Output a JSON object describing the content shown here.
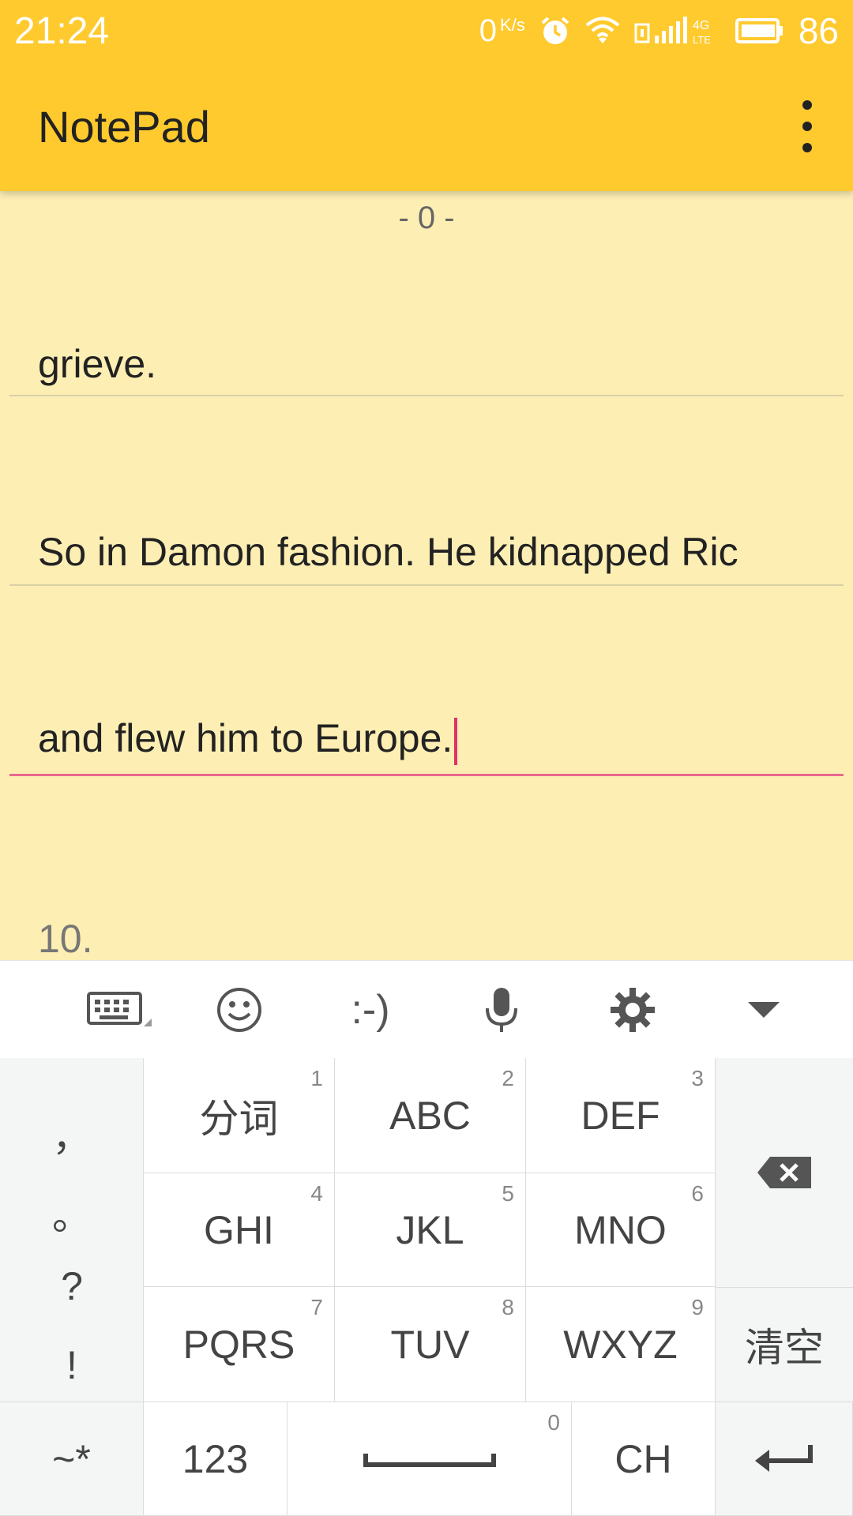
{
  "status_bar": {
    "time": "21:24",
    "net_speed": "0",
    "net_unit": "K/s",
    "battery": "86",
    "icons": [
      "alarm-icon",
      "wifi-icon",
      "sim-icon",
      "signal-icon",
      "lte-icon",
      "battery-icon"
    ]
  },
  "app_bar": {
    "title": "NotePad",
    "menu_icon": "more-vert-icon"
  },
  "note": {
    "page_number": "- 0 -",
    "lines": [
      {
        "text": "grieve."
      },
      {
        "text": "So in Damon fashion. He kidnapped Ric"
      },
      {
        "text": "and flew him to Europe."
      }
    ],
    "next_line_number": "10."
  },
  "keyboard": {
    "toolbar": [
      {
        "icon": "keyboard-icon"
      },
      {
        "icon": "smiley-icon"
      },
      {
        "label": ":-)"
      },
      {
        "icon": "microphone-icon"
      },
      {
        "icon": "gear-icon"
      },
      {
        "icon": "collapse-down-icon"
      }
    ],
    "punctuation": [
      "，",
      "。",
      "?",
      "!"
    ],
    "keys": [
      {
        "label": "分词",
        "digit": "1"
      },
      {
        "label": "ABC",
        "digit": "2"
      },
      {
        "label": "DEF",
        "digit": "3"
      },
      {
        "label": "GHI",
        "digit": "4"
      },
      {
        "label": "JKL",
        "digit": "5"
      },
      {
        "label": "MNO",
        "digit": "6"
      },
      {
        "label": "PQRS",
        "digit": "7"
      },
      {
        "label": "TUV",
        "digit": "8"
      },
      {
        "label": "WXYZ",
        "digit": "9"
      }
    ],
    "backspace_icon": "backspace-icon",
    "clear_label": "清空",
    "bottom_row": {
      "symbols": "~*",
      "numbers": "123",
      "space_digit": "0",
      "lang": "CH",
      "enter_icon": "enter-icon"
    }
  }
}
